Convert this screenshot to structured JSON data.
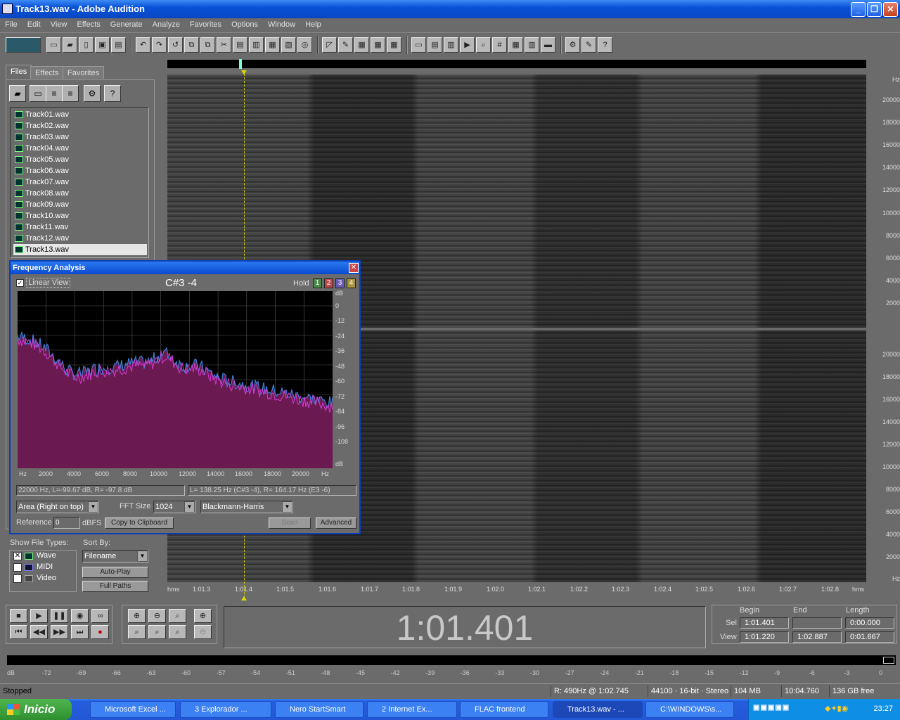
{
  "window": {
    "title": "Track13.wav - Adobe Audition",
    "min": "_",
    "max": "❐",
    "close": "✕"
  },
  "menu": [
    "File",
    "Edit",
    "View",
    "Effects",
    "Generate",
    "Analyze",
    "Favorites",
    "Options",
    "Window",
    "Help"
  ],
  "panel": {
    "tabs": [
      "Files",
      "Effects",
      "Favorites"
    ],
    "files": [
      "Track01.wav",
      "Track02.wav",
      "Track03.wav",
      "Track04.wav",
      "Track05.wav",
      "Track06.wav",
      "Track07.wav",
      "Track08.wav",
      "Track09.wav",
      "Track10.wav",
      "Track11.wav",
      "Track12.wav",
      "Track13.wav"
    ],
    "selected_file": "Track13.wav",
    "show_label": "Show File Types:",
    "types": [
      {
        "label": "Wave",
        "checked": true
      },
      {
        "label": "MIDI",
        "checked": false
      },
      {
        "label": "Video",
        "checked": false
      }
    ],
    "sort_label": "Sort By:",
    "sort_value": "Filename",
    "autoplay": "Auto-Play",
    "fullpaths": "Full Paths"
  },
  "spectral": {
    "hz_unit": "Hz",
    "hz_labels": [
      "20000",
      "18000",
      "16000",
      "14000",
      "12000",
      "10000",
      "8000",
      "6000",
      "4000",
      "2000"
    ],
    "time_unit": "hms",
    "time_labels": [
      "1:01.3",
      "1:01.4",
      "1:01.5",
      "1:01.6",
      "1:01.7",
      "1:01.8",
      "1:01.9",
      "1:02.0",
      "1:02.1",
      "1:02.2",
      "1:02.3",
      "1:02.4",
      "1:02.5",
      "1:02.6",
      "1:02.7",
      "1:02.8"
    ]
  },
  "freq": {
    "title": "Frequency Analysis",
    "linear_label": "Linear View",
    "note": "C#3 -4",
    "hold_label": "Hold",
    "hold_buttons": [
      "1",
      "2",
      "3",
      "4"
    ],
    "db_labels": [
      "dB",
      "0",
      "-12",
      "-24",
      "-36",
      "-48",
      "-60",
      "-72",
      "-84",
      "-96",
      "-108",
      "dB"
    ],
    "x_labels": [
      "Hz",
      "2000",
      "4000",
      "6000",
      "8000",
      "10000",
      "12000",
      "14000",
      "16000",
      "18000",
      "20000",
      "Hz"
    ],
    "info_left": "22000 Hz, L=-99.67 dB, R= -97.8 dB",
    "info_right": "L= 138.25 Hz (C#3 -4), R= 164.17 Hz (E3 -6)",
    "display_mode": "Area (Right on top)",
    "fft_label": "FFT Size",
    "fft_value": "1024",
    "window_fn": "Blackmann-Harris",
    "ref_label": "Reference",
    "ref_value": "0",
    "ref_unit": "dBFS",
    "copy_btn": "Copy to Clipboard",
    "scan_btn": "Scan",
    "advanced_btn": "Advanced",
    "colors": {
      "left": "#d63ad6",
      "right": "#3a7fd6",
      "fill": "#6a1a50"
    }
  },
  "time_display": "1:01.401",
  "selection": {
    "begin_label": "Begin",
    "end_label": "End",
    "length_label": "Length",
    "sel_label": "Sel",
    "view_label": "View",
    "sel_begin": "1:01.401",
    "sel_end": "",
    "sel_length": "0:00.000",
    "view_begin": "1:01.220",
    "view_end": "1:02.887",
    "view_length": "0:01.667"
  },
  "level_labels": [
    "dB",
    "-72",
    "-69",
    "-66",
    "-63",
    "-60",
    "-57",
    "-54",
    "-51",
    "-48",
    "-45",
    "-42",
    "-39",
    "-36",
    "-33",
    "-30",
    "-27",
    "-24",
    "-21",
    "-18",
    "-15",
    "-12",
    "-9",
    "-6",
    "-3",
    "0"
  ],
  "status": {
    "state": "Stopped",
    "cursor": "R: 490Hz @  1:02.745",
    "format": "44100 · 16-bit · Stereo",
    "size": "104 MB",
    "duration": "10:04.760",
    "free": "136 GB free"
  },
  "taskbar": {
    "start": "Inicio",
    "tasks": [
      "Microsoft Excel ...",
      "3 Explorador ...",
      "Nero StartSmart",
      "2 Internet Ex...",
      "FLAC frontend",
      "Track13.wav - ...",
      "C:\\WINDOWS\\s..."
    ],
    "active_task": 5,
    "clock": "23:27"
  }
}
